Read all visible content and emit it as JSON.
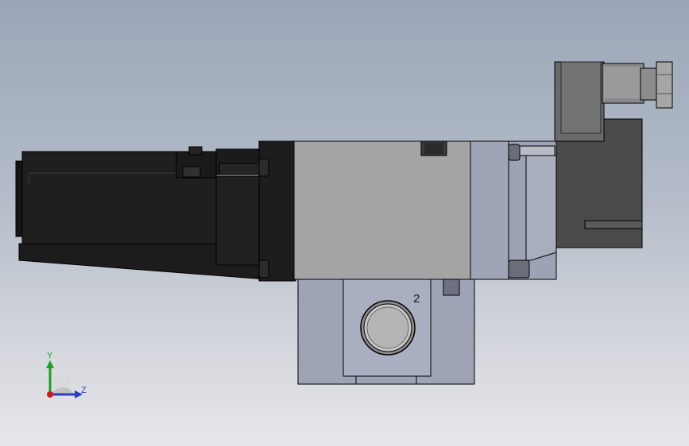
{
  "model": {
    "port_label": "2"
  },
  "triad": {
    "y_label": "Y",
    "z_label": "Z",
    "y_color": "#1aa31a",
    "z_color": "#2b3fc4",
    "origin_color": "#d01a1a"
  },
  "colors": {
    "background_top": "#9aa6b8",
    "background_bottom": "#e6e7ea",
    "body_gray": "#a4a4a4",
    "body_dark": "#1e1e1e",
    "base_blue_gray": "#9ea3b5",
    "coil_dark": "#4a4a4a"
  }
}
